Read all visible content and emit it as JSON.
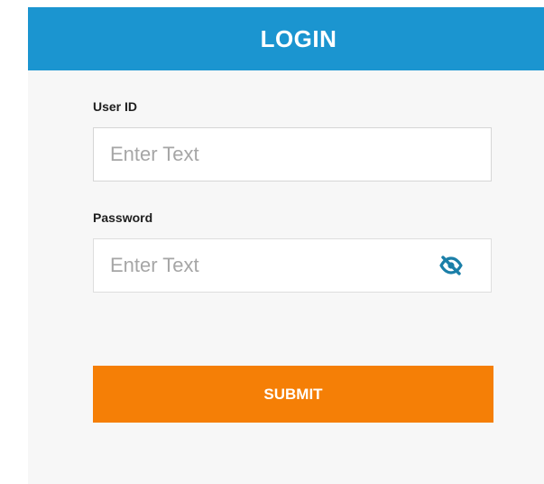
{
  "header": {
    "title": "LOGIN"
  },
  "form": {
    "user_id": {
      "label": "User ID",
      "placeholder": "Enter Text",
      "value": ""
    },
    "password": {
      "label": "Password",
      "placeholder": "Enter Text",
      "value": "",
      "toggle_icon": "eye-slash-icon"
    },
    "submit_label": "SUBMIT"
  },
  "colors": {
    "header_bg": "#1b95d0",
    "accent_submit": "#f57f06",
    "eye_icon": "#1b7fa8",
    "card_bg": "#f7f7f7"
  }
}
